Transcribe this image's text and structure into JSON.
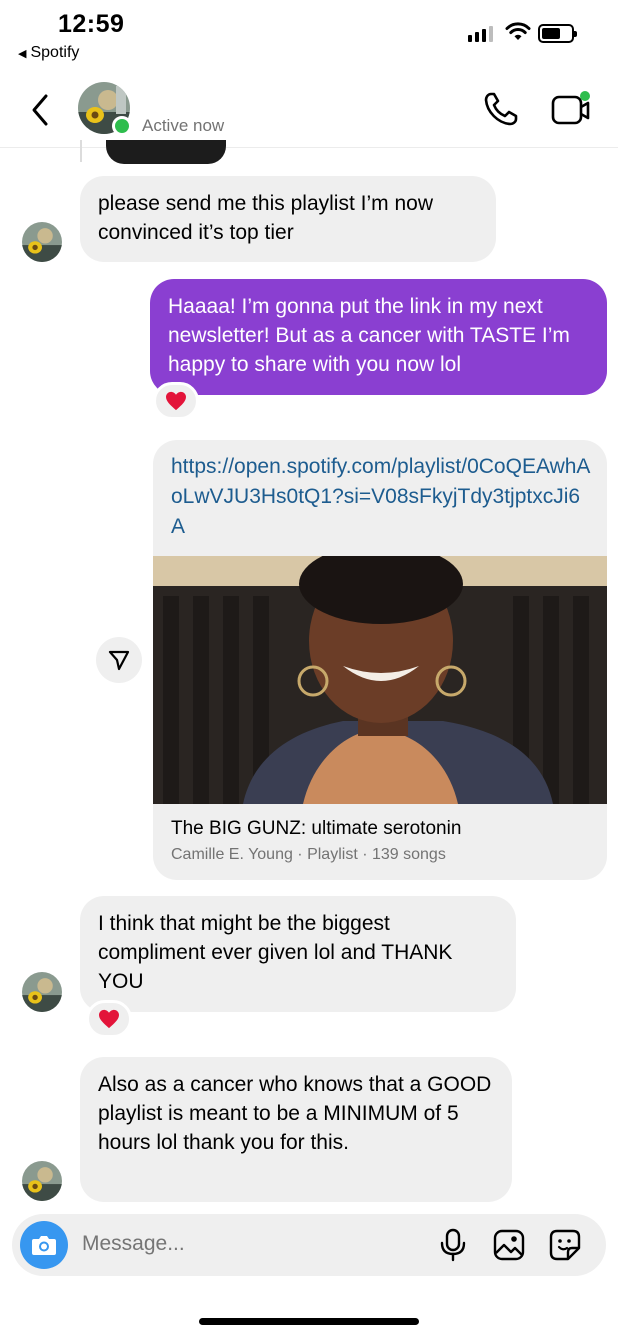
{
  "status_bar": {
    "time": "12:59",
    "back_app": "Spotify"
  },
  "header": {
    "status": "Active now"
  },
  "messages": [
    {
      "text": "please send me this playlist I’m now convinced it’s top tier"
    },
    {
      "text": "Haaaa! I’m gonna put the link in my next newsletter! But as a cancer with TASTE I’m happy to share with you now lol",
      "reaction": "heart"
    },
    {
      "text": "I think that might be the biggest compliment ever given lol and THANK YOU",
      "reaction": "heart"
    },
    {
      "text": "Also as a cancer who knows that a GOOD playlist is meant to be a MINIMUM of 5 hours lol thank you for this."
    }
  ],
  "link_preview": {
    "url": "https://open.spotify.com/playlist/0CoQEAwhAoLwVJU3Hs0tQ1?si=V08sFkyjTdy3tjptxcJi6A",
    "title": "The BIG GUNZ: ultimate serotonin",
    "subtitle": "Camille E. Young · Playlist · 139 songs"
  },
  "composer": {
    "placeholder": "Message..."
  },
  "icons": [
    "back-chevron-icon",
    "phone-icon",
    "video-call-icon",
    "heart-icon",
    "share-arrow-icon",
    "camera-icon",
    "microphone-icon",
    "gallery-icon",
    "sticker-icon"
  ],
  "colors": {
    "outgoing_bubble": "#8a3fd1",
    "incoming_bubble": "#efefef",
    "online_dot": "#2ebd4d",
    "camera_button": "#3797f0",
    "link_text": "#1d5c8f",
    "heart": "#e3143a"
  }
}
